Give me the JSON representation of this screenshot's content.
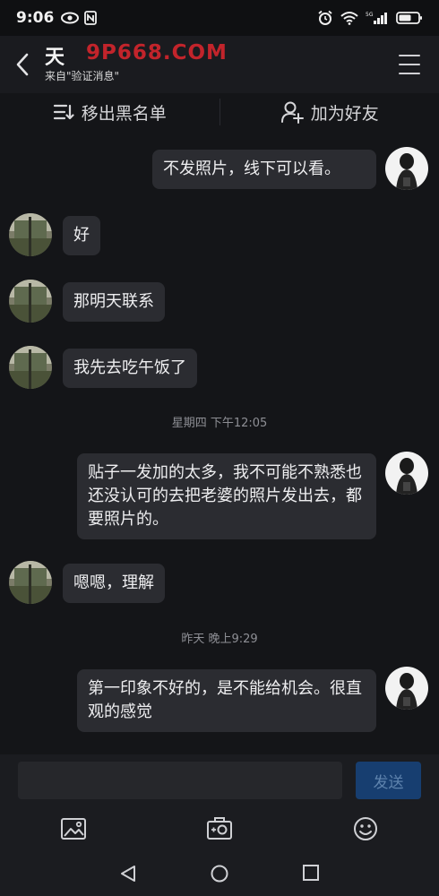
{
  "status_bar": {
    "time": "9:06",
    "left_icons": [
      "eye-icon",
      "nfc-icon"
    ],
    "right_icons": [
      "alarm-icon",
      "wifi-icon",
      "5g-signal-icon",
      "battery-icon"
    ],
    "network_label": "5G"
  },
  "header": {
    "title": "天",
    "subtitle": "来自\"验证消息\"",
    "watermark": "9P668.COM"
  },
  "actions": {
    "remove_blacklist": "移出黑名单",
    "add_friend": "加为好友"
  },
  "messages": [
    {
      "side": "right",
      "text": "不发照片，线下可以看。"
    },
    {
      "side": "left",
      "text": "好"
    },
    {
      "side": "left",
      "text": "那明天联系"
    },
    {
      "side": "left",
      "text": "我先去吃午饭了"
    },
    {
      "type": "time",
      "text": "星期四 下午12:05"
    },
    {
      "side": "right",
      "text": "贴子一发加的太多，我不可能不熟悉也还没认可的去把老婆的照片发出去，都要照片的。"
    },
    {
      "side": "left",
      "text": "嗯嗯，理解"
    },
    {
      "type": "time",
      "text": "昨天 晚上9:29"
    },
    {
      "side": "right",
      "text": "第一印象不好的，是不能给机会。很直观的感觉"
    }
  ],
  "input": {
    "placeholder": "",
    "send_label": "发送"
  },
  "toolbar": [
    "image-icon",
    "camera-icon",
    "emoji-icon"
  ],
  "navbar": [
    "back-triangle-icon",
    "home-circle-icon",
    "recents-square-icon"
  ],
  "colors": {
    "background": "#141518",
    "bubble": "#2b2c31",
    "send_button": "#173e70",
    "watermark": "#c2242b"
  }
}
